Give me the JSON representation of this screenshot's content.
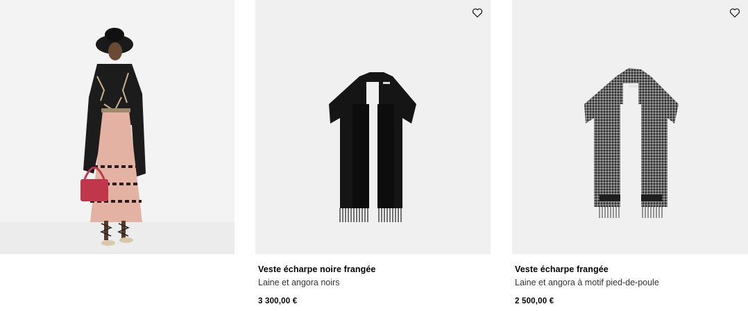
{
  "look": {
    "icon": "model-look-image"
  },
  "products": [
    {
      "name": "Veste écharpe noire frangée",
      "description": "Laine et angora noirs",
      "price": "3 300,00 €",
      "wishlist_icon": "heart-icon",
      "image_icon": "black-fringed-scarf-jacket-image"
    },
    {
      "name": "Veste écharpe frangée",
      "description": "Laine et angora à motif pied-de-poule",
      "price": "2 500,00 €",
      "wishlist_icon": "heart-icon",
      "image_icon": "houndstooth-fringed-scarf-jacket-image"
    }
  ],
  "colors": {
    "card_background": "#f0f0f0",
    "text": "#000000",
    "accent_bag": "#c0364a"
  }
}
